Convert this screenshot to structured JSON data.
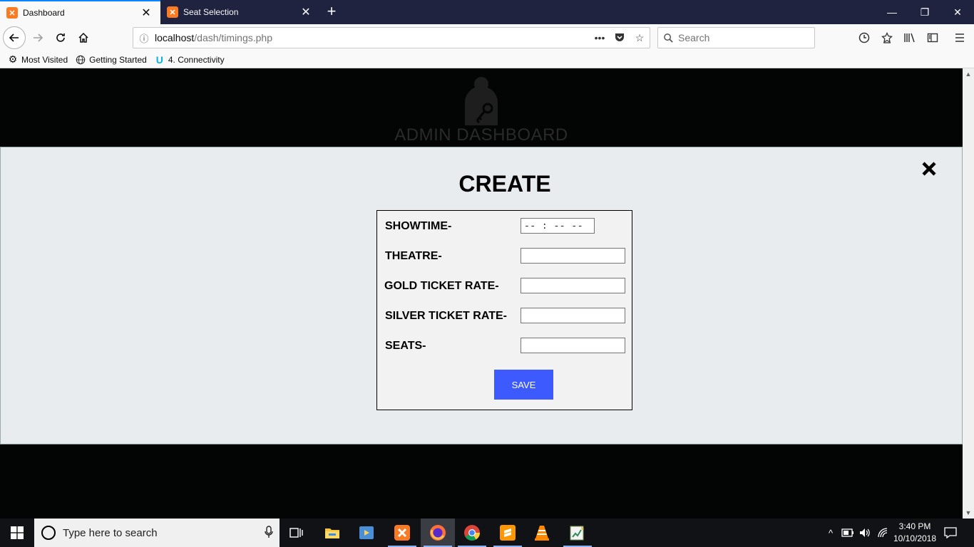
{
  "browser": {
    "tabs": [
      {
        "label": "Dashboard",
        "active": true
      },
      {
        "label": "Seat Selection",
        "active": false
      }
    ],
    "url_host": "localhost",
    "url_path": "/dash/timings.php",
    "search_placeholder": "Search",
    "bookmarks": [
      {
        "label": "Most Visited",
        "icon": "gear-icon"
      },
      {
        "label": "Getting Started",
        "icon": "globe-icon"
      },
      {
        "label": "4. Connectivity",
        "icon": "udacity-icon"
      }
    ]
  },
  "page": {
    "header_title": "ADMIN DASHBOARD",
    "modal": {
      "title": "CREATE",
      "fields": [
        {
          "label": "SHOWTIME-",
          "type": "time",
          "value": "-- : --   --"
        },
        {
          "label": "THEATRE-",
          "type": "text",
          "value": ""
        },
        {
          "label": "GOLD TICKET RATE-",
          "type": "text",
          "value": ""
        },
        {
          "label": "SILVER TICKET RATE-",
          "type": "text",
          "value": ""
        },
        {
          "label": "SEATS-",
          "type": "text",
          "value": ""
        }
      ],
      "save_label": "SAVE",
      "save_color": "#3d5afe"
    }
  },
  "taskbar": {
    "search_placeholder": "Type here to search",
    "time": "3:40 PM",
    "date": "10/10/2018",
    "apps": [
      "task-view-icon",
      "file-explorer-icon",
      "media-player-icon",
      "xampp-icon",
      "firefox-icon",
      "chrome-icon",
      "sublime-text-icon",
      "vlc-icon",
      "notepad-chart-icon"
    ]
  },
  "colors": {
    "tab_strip": "#202340",
    "toolbar": "#f9f9fa",
    "page_bg": "#030404",
    "modal_bg": "#e9ecef",
    "accent": "#0a84ff"
  }
}
